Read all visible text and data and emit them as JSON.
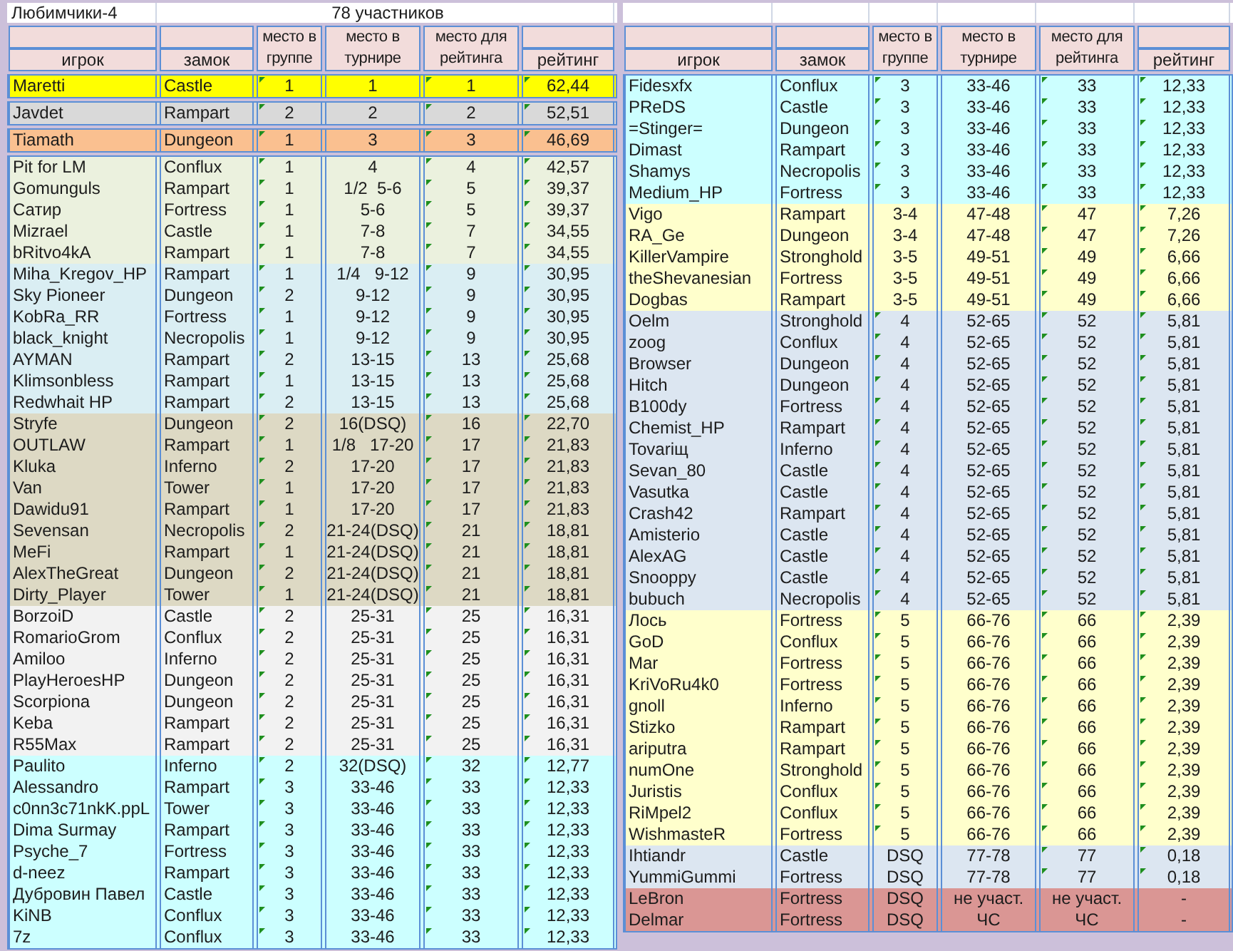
{
  "tables": [
    {
      "title": "Любимчики-4",
      "subtitle": "78 участников",
      "columns": [
        {
          "label": "игрок",
          "kind": "split"
        },
        {
          "label": "замок",
          "kind": "split"
        },
        {
          "label": "место в группе",
          "kind": "tall"
        },
        {
          "label": "место в турнире",
          "kind": "tall"
        },
        {
          "label": "место для рейтинга",
          "kind": "tall"
        },
        {
          "label": "рейтинг",
          "kind": "split"
        }
      ],
      "blocks": [
        {
          "bands": [
            {
              "color": "#ffff00",
              "rows": [
                [
                  "Maretti",
                  "Castle",
                  "1",
                  "1",
                  "1",
                  "62,44"
                ]
              ]
            }
          ]
        },
        {
          "bands": [
            {
              "color": "#d9d9d9",
              "rows": [
                [
                  "Javdet",
                  "Rampart",
                  "2",
                  "2",
                  "2",
                  "52,51"
                ]
              ]
            }
          ]
        },
        {
          "bands": [
            {
              "color": "#fac090",
              "rows": [
                [
                  "Tiamath",
                  "Dungeon",
                  "1",
                  "3",
                  "3",
                  "46,69"
                ]
              ]
            }
          ]
        },
        {
          "bands": [
            {
              "color": "#ebf1de",
              "rows": [
                [
                  "Pit for LM",
                  "Conflux",
                  "1",
                  "4",
                  "4",
                  "42,57"
                ],
                [
                  "Gomunguls",
                  "Rampart",
                  "1",
                  "1/2  5-6",
                  "5",
                  "39,37"
                ],
                [
                  "Сатир",
                  "Fortress",
                  "1",
                  "5-6",
                  "5",
                  "39,37"
                ],
                [
                  "Mizrael",
                  "Castle",
                  "1",
                  "7-8",
                  "7",
                  "34,55"
                ],
                [
                  "bRitvo4kA",
                  "Rampart",
                  "1",
                  "7-8",
                  "7",
                  "34,55"
                ]
              ]
            },
            {
              "color": "#daeef3",
              "rows": [
                [
                  "Miha_Kregov_HP",
                  "Rampart",
                  "1",
                  "1/4   9-12",
                  "9",
                  "30,95"
                ],
                [
                  "Sky Pioneer",
                  "Dungeon",
                  "2",
                  "9-12",
                  "9",
                  "30,95"
                ],
                [
                  "KobRa_RR",
                  "Fortress",
                  "1",
                  "9-12",
                  "9",
                  "30,95"
                ],
                [
                  "black_knight",
                  "Necropolis",
                  "1",
                  "9-12",
                  "9",
                  "30,95"
                ],
                [
                  "AYMAN",
                  "Rampart",
                  "2",
                  "13-15",
                  "13",
                  "25,68"
                ],
                [
                  "Klimsonbless",
                  "Rampart",
                  "1",
                  "13-15",
                  "13",
                  "25,68"
                ],
                [
                  "Redwhait HP",
                  "Rampart",
                  "2",
                  "13-15",
                  "13",
                  "25,68"
                ]
              ]
            },
            {
              "color": "#ddd9c4",
              "rows": [
                [
                  "Stryfe",
                  "Dungeon",
                  "2",
                  "16(DSQ)",
                  "16",
                  "22,70"
                ],
                [
                  "OUTLAW",
                  "Rampart",
                  "1",
                  "1/8   17-20",
                  "17",
                  "21,83"
                ],
                [
                  "Kluka",
                  "Inferno",
                  "2",
                  "17-20",
                  "17",
                  "21,83"
                ],
                [
                  "Van",
                  "Tower",
                  "1",
                  "17-20",
                  "17",
                  "21,83"
                ],
                [
                  "Dawidu91",
                  "Rampart",
                  "1",
                  "17-20",
                  "17",
                  "21,83"
                ],
                [
                  "Sevensan",
                  "Necropolis",
                  "2",
                  "21-24(DSQ)",
                  "21",
                  "18,81"
                ],
                [
                  "MeFi",
                  "Rampart",
                  "1",
                  "21-24(DSQ)",
                  "21",
                  "18,81"
                ],
                [
                  "AlexTheGreat",
                  "Dungeon",
                  "2",
                  "21-24(DSQ)",
                  "21",
                  "18,81"
                ],
                [
                  "Dirty_Player",
                  "Tower",
                  "1",
                  "21-24(DSQ)",
                  "21",
                  "18,81"
                ]
              ]
            },
            {
              "color": "#f2f2f2",
              "rows": [
                [
                  "BorzoiD",
                  "Castle",
                  "2",
                  "25-31",
                  "25",
                  "16,31"
                ],
                [
                  "RomarioGrom",
                  "Conflux",
                  "2",
                  "25-31",
                  "25",
                  "16,31"
                ],
                [
                  "Amiloo",
                  "Inferno",
                  "2",
                  "25-31",
                  "25",
                  "16,31"
                ],
                [
                  "PlayHeroesHP",
                  "Dungeon",
                  "2",
                  "25-31",
                  "25",
                  "16,31"
                ],
                [
                  "Scorpiona",
                  "Dungeon",
                  "2",
                  "25-31",
                  "25",
                  "16,31"
                ],
                [
                  "Keba",
                  "Rampart",
                  "2",
                  "25-31",
                  "25",
                  "16,31"
                ],
                [
                  "R55Max",
                  "Rampart",
                  "2",
                  "25-31",
                  "25",
                  "16,31"
                ]
              ]
            },
            {
              "color": "#ccffff",
              "rows": [
                [
                  "Paulito",
                  "Inferno",
                  "2",
                  "32(DSQ)",
                  "32",
                  "12,77"
                ],
                [
                  "Alessandro",
                  "Rampart",
                  "3",
                  "33-46",
                  "33",
                  "12,33"
                ],
                [
                  "c0nn3c71nkK.ppL",
                  "Tower",
                  "3",
                  "33-46",
                  "33",
                  "12,33"
                ],
                [
                  "Dima Surmay",
                  "Rampart",
                  "3",
                  "33-46",
                  "33",
                  "12,33"
                ],
                [
                  "Psyche_7",
                  "Fortress",
                  "3",
                  "33-46",
                  "33",
                  "12,33"
                ],
                [
                  "d-neez",
                  "Rampart",
                  "3",
                  "33-46",
                  "33",
                  "12,33"
                ],
                [
                  "Дубровин Павел",
                  "Castle",
                  "3",
                  "33-46",
                  "33",
                  "12,33"
                ],
                [
                  "KiNB",
                  "Conflux",
                  "3",
                  "33-46",
                  "33",
                  "12,33"
                ],
                [
                  "7z",
                  "Conflux",
                  "3",
                  "33-46",
                  "33",
                  "12,33"
                ]
              ]
            }
          ]
        }
      ]
    },
    {
      "columns": [
        {
          "label": "игрок",
          "kind": "split"
        },
        {
          "label": "замок",
          "kind": "split"
        },
        {
          "label": "место в группе",
          "kind": "tall"
        },
        {
          "label": "место в турнире",
          "kind": "tall"
        },
        {
          "label": "место для рейтинга",
          "kind": "tall"
        },
        {
          "label": "рейтинг",
          "kind": "split"
        }
      ],
      "blocks": [
        {
          "bands": [
            {
              "color": "#ccffff",
              "rows": [
                [
                  "Fidesxfx",
                  "Conflux",
                  "3",
                  "33-46",
                  "33",
                  "12,33"
                ],
                [
                  "PReDS",
                  "Castle",
                  "3",
                  "33-46",
                  "33",
                  "12,33"
                ],
                [
                  "=Stinger=",
                  "Dungeon",
                  "3",
                  "33-46",
                  "33",
                  "12,33"
                ],
                [
                  "Dimast",
                  "Rampart",
                  "3",
                  "33-46",
                  "33",
                  "12,33"
                ],
                [
                  "Shamys",
                  "Necropolis",
                  "3",
                  "33-46",
                  "33",
                  "12,33"
                ],
                [
                  "Medium_HP",
                  "Fortress",
                  "3",
                  "33-46",
                  "33",
                  "12,33"
                ]
              ]
            },
            {
              "color": "#ffffcc",
              "rows": [
                [
                  "Vigo",
                  "Rampart",
                  "3-4",
                  "47-48",
                  "47",
                  "7,26"
                ],
                [
                  "RA_Ge",
                  "Dungeon",
                  "3-4",
                  "47-48",
                  "47",
                  "7,26"
                ],
                [
                  "KillerVampire",
                  "Stronghold",
                  "3-5",
                  "49-51",
                  "49",
                  "6,66"
                ],
                [
                  "theShevanesian",
                  "Fortress",
                  "3-5",
                  "49-51",
                  "49",
                  "6,66"
                ],
                [
                  "Dogbas",
                  "Rampart",
                  "3-5",
                  "49-51",
                  "49",
                  "6,66"
                ]
              ]
            },
            {
              "color": "#dce6f1",
              "rows": [
                [
                  "Oelm",
                  "Stronghold",
                  "4",
                  "52-65",
                  "52",
                  "5,81"
                ],
                [
                  "zoog",
                  "Conflux",
                  "4",
                  "52-65",
                  "52",
                  "5,81"
                ],
                [
                  "Browser",
                  "Dungeon",
                  "4",
                  "52-65",
                  "52",
                  "5,81"
                ],
                [
                  "Hitch",
                  "Dungeon",
                  "4",
                  "52-65",
                  "52",
                  "5,81"
                ],
                [
                  "B100dy",
                  "Fortress",
                  "4",
                  "52-65",
                  "52",
                  "5,81"
                ],
                [
                  "Chemist_HP",
                  "Rampart",
                  "4",
                  "52-65",
                  "52",
                  "5,81"
                ],
                [
                  "Tovariщ",
                  "Inferno",
                  "4",
                  "52-65",
                  "52",
                  "5,81"
                ],
                [
                  "Sevan_80",
                  "Castle",
                  "4",
                  "52-65",
                  "52",
                  "5,81"
                ],
                [
                  "Vasutka",
                  "Castle",
                  "4",
                  "52-65",
                  "52",
                  "5,81"
                ],
                [
                  "Crash42",
                  "Rampart",
                  "4",
                  "52-65",
                  "52",
                  "5,81"
                ],
                [
                  "Amisterio",
                  "Castle",
                  "4",
                  "52-65",
                  "52",
                  "5,81"
                ],
                [
                  "AlexAG",
                  "Castle",
                  "4",
                  "52-65",
                  "52",
                  "5,81"
                ],
                [
                  "Snooppy",
                  "Castle",
                  "4",
                  "52-65",
                  "52",
                  "5,81"
                ],
                [
                  "bubuch",
                  "Necropolis",
                  "4",
                  "52-65",
                  "52",
                  "5,81"
                ]
              ]
            },
            {
              "color": "#ffffcc",
              "rows": [
                [
                  "Лось",
                  "Fortress",
                  "5",
                  "66-76",
                  "66",
                  "2,39"
                ],
                [
                  "GoD",
                  "Conflux",
                  "5",
                  "66-76",
                  "66",
                  "2,39"
                ],
                [
                  "Mar",
                  "Fortress",
                  "5",
                  "66-76",
                  "66",
                  "2,39"
                ],
                [
                  "KriVoRu4k0",
                  "Fortress",
                  "5",
                  "66-76",
                  "66",
                  "2,39"
                ],
                [
                  "gnoll",
                  "Inferno",
                  "5",
                  "66-76",
                  "66",
                  "2,39"
                ],
                [
                  "Stizko",
                  "Rampart",
                  "5",
                  "66-76",
                  "66",
                  "2,39"
                ],
                [
                  "ariputra",
                  "Rampart",
                  "5",
                  "66-76",
                  "66",
                  "2,39"
                ],
                [
                  "numOne",
                  "Stronghold",
                  "5",
                  "66-76",
                  "66",
                  "2,39"
                ],
                [
                  "Juristis",
                  "Conflux",
                  "5",
                  "66-76",
                  "66",
                  "2,39"
                ],
                [
                  "RiMpel2",
                  "Conflux",
                  "5",
                  "66-76",
                  "66",
                  "2,39"
                ],
                [
                  "WishmasteR",
                  "Fortress",
                  "5",
                  "66-76",
                  "66",
                  "2,39"
                ]
              ]
            },
            {
              "color": "#dce6f1",
              "rows": [
                [
                  "Ihtiandr",
                  "Castle",
                  "DSQ",
                  "77-78",
                  "77",
                  "0,18"
                ],
                [
                  "YummiGummi",
                  "Fortress",
                  "DSQ",
                  "77-78",
                  "77",
                  "0,18"
                ]
              ]
            },
            {
              "color": "#da9694",
              "rows": [
                [
                  "LeBron",
                  "Fortress",
                  "DSQ",
                  "не участ.",
                  "не участ.",
                  "-"
                ],
                [
                  "Delmar",
                  "Fortress",
                  "DSQ",
                  "ЧС",
                  "ЧС",
                  "-"
                ]
              ]
            }
          ]
        }
      ]
    }
  ]
}
